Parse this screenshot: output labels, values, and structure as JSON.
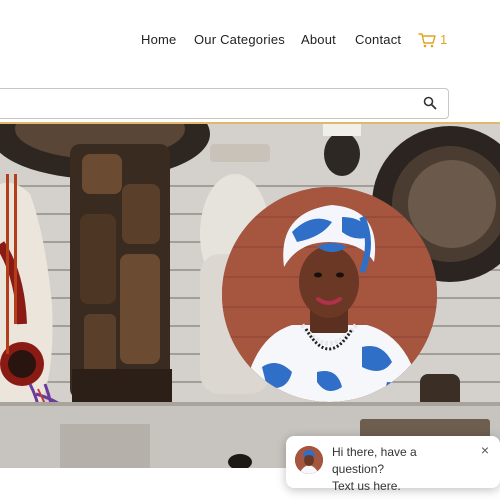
{
  "nav": {
    "items": [
      {
        "label": "Home"
      },
      {
        "label": "Our Categories"
      },
      {
        "label": "About"
      },
      {
        "label": "Contact"
      }
    ],
    "cart_count": "1",
    "accent_color": "#e0a321"
  },
  "search": {
    "value": "",
    "placeholder": ""
  },
  "chat": {
    "line1": "Hi there, have a question?",
    "line2": "Text us here.",
    "close_glyph": "×"
  },
  "icons": [
    "cart-icon",
    "search-icon",
    "close-icon"
  ]
}
